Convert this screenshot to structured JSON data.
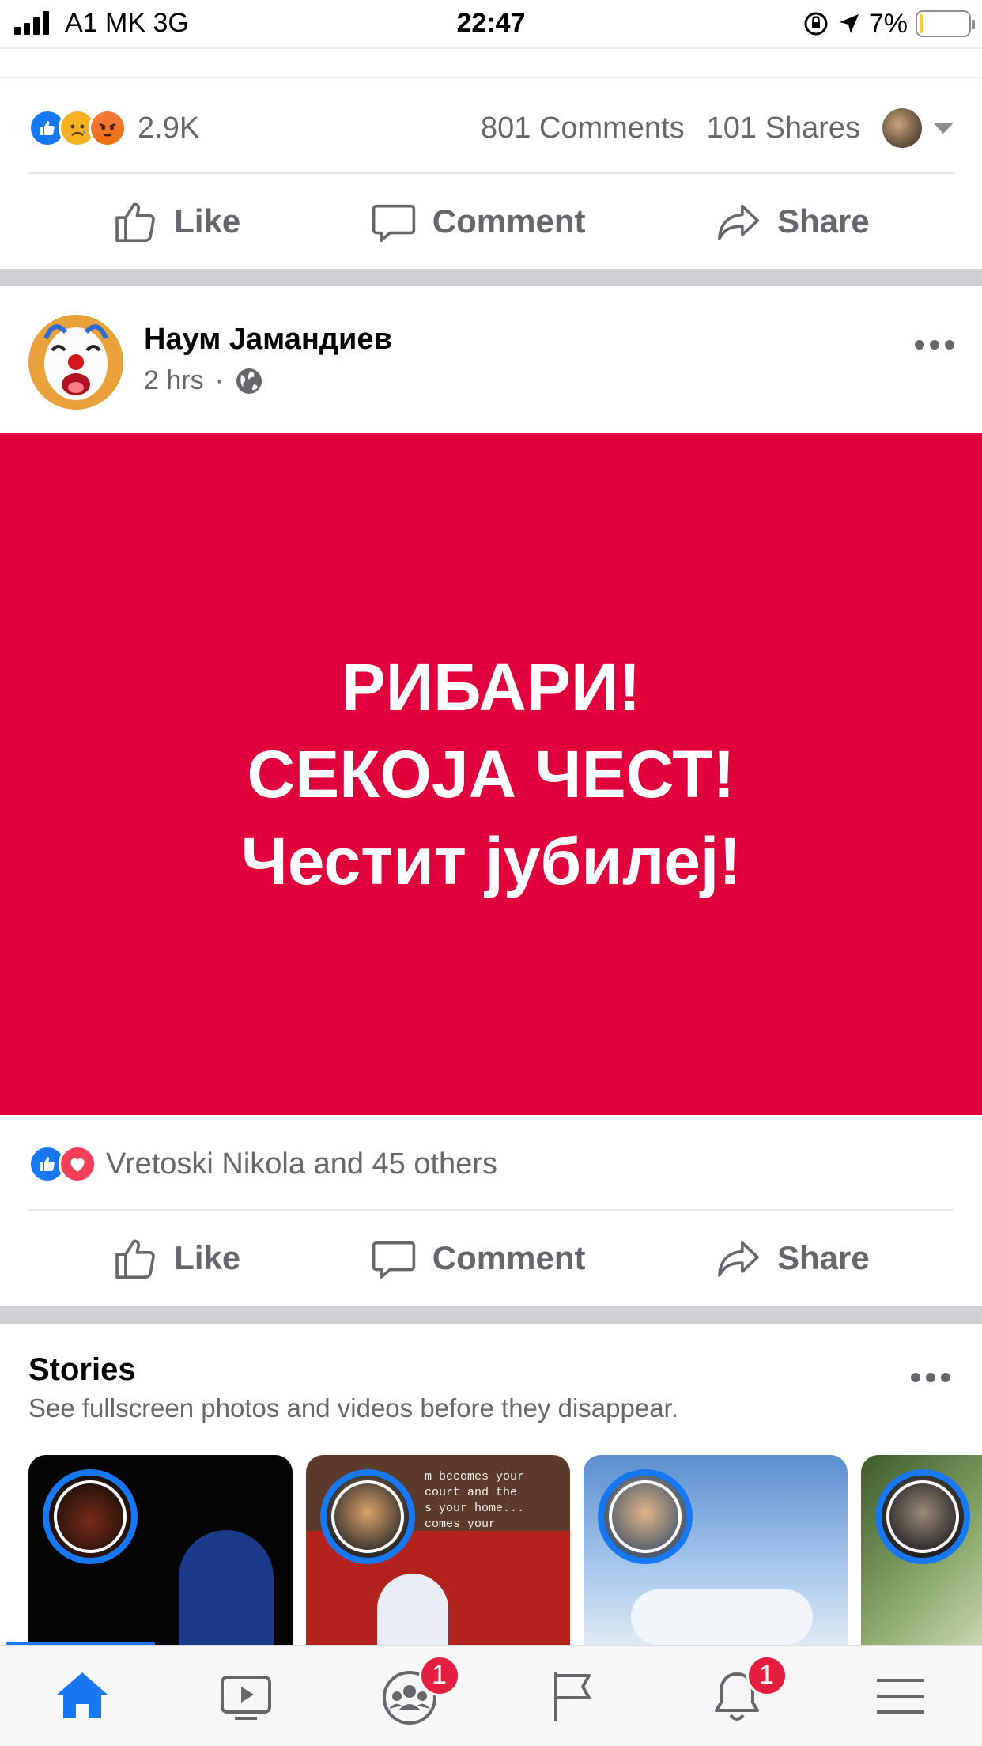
{
  "status_bar": {
    "carrier": "A1 MK   3G",
    "time": "22:47",
    "battery_pct": "7%",
    "battery_level": 0.07
  },
  "prev_post": {
    "reaction_count": "2.9K",
    "comments": "801 Comments",
    "shares": "101 Shares"
  },
  "actions": {
    "like": "Like",
    "comment": "Comment",
    "share": "Share"
  },
  "post": {
    "author": "Наум Јамандиев",
    "time": "2 hrs",
    "dot": "·",
    "image_lines": [
      "РИБАРИ!",
      "СЕКОЈА ЧЕСТ!",
      "Честит јубилеј!"
    ],
    "likers": "Vretoski Nikola and 45 others"
  },
  "stories": {
    "title": "Stories",
    "subtitle": "See fullscreen photos and videos before they disappear.",
    "caption_lines": [
      "m becomes your",
      "court and the",
      "s your home...",
      "comes your"
    ]
  },
  "tabbar": {
    "groups_badge": "1",
    "notifications_badge": "1"
  },
  "colors": {
    "brand_blue": "#1877f2",
    "post_red": "#e0003c",
    "badge_red": "#e41e3f"
  }
}
